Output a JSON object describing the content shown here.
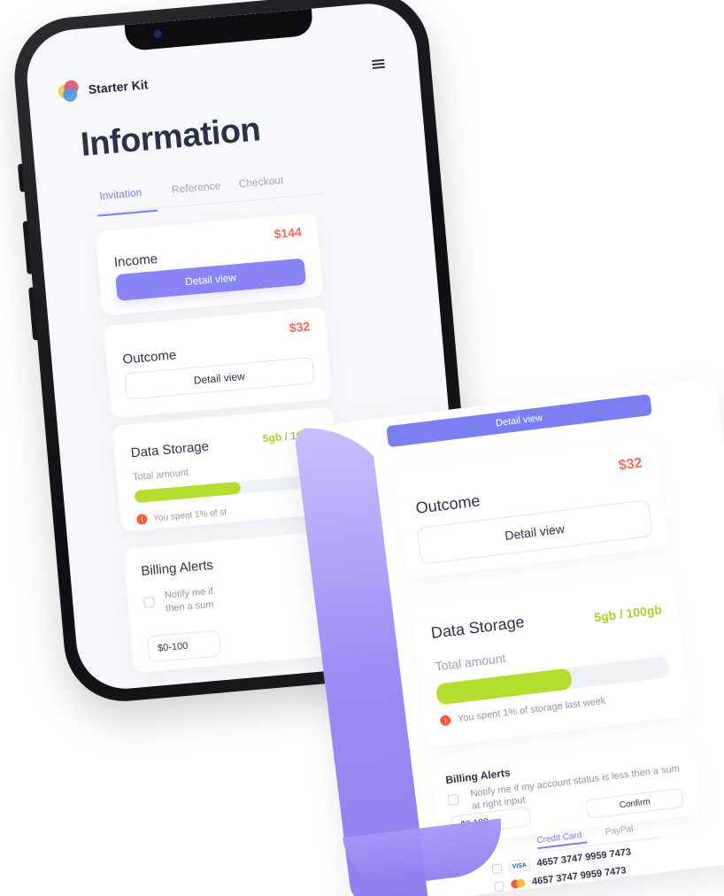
{
  "brand": {
    "name": "Starter Kit"
  },
  "page": {
    "title": "Information"
  },
  "tabs": [
    {
      "label": "Invitation"
    },
    {
      "label": "Reference"
    },
    {
      "label": "Checkout"
    }
  ],
  "phone": {
    "income": {
      "title": "Income",
      "amount": "$144",
      "button": "Detail view"
    },
    "outcome": {
      "title": "Outcome",
      "amount": "$32",
      "button": "Detail view"
    },
    "storage": {
      "title": "Data Storage",
      "metric": "5gb  /  100gb",
      "subtitle": "Total amount",
      "warning": "You spent 1% of st",
      "progress": 0.56
    },
    "billing": {
      "title": "Billing Alerts",
      "text_line1": "Notify me if",
      "text_line2": "then a sum",
      "select_value": "$0-100"
    }
  },
  "paper": {
    "top_button": "Detail view",
    "outcome": {
      "title": "Outcome",
      "amount": "$32",
      "button": "Detail view"
    },
    "storage": {
      "title": "Data Storage",
      "metric": "5gb  /  100gb",
      "subtitle": "Total amount",
      "warning": "You spent 1% of storage last week",
      "progress": 0.58
    },
    "billing": {
      "title": "Billing Alerts",
      "text": "Notify me if my account status is less then a sum at right input",
      "select_value": "$0-100",
      "confirm": "Confirm"
    },
    "payment_tabs": [
      {
        "label": "Credit Card"
      },
      {
        "label": "PayPal"
      }
    ],
    "payment_rows": [
      {
        "brand": "VISA",
        "number": "4657 3747 9959 7473"
      },
      {
        "brand": "mastercard",
        "number": "4657 3747 9959 7473"
      }
    ]
  },
  "icons": {
    "menu": "menu-icon",
    "logo": "starter-kit-logo",
    "warning": "warning-icon",
    "visa": "visa-icon",
    "mastercard": "mastercard-icon"
  },
  "colors": {
    "accent": "#7b7ff2",
    "accent_soft": "#8b84f6",
    "amount": "#ef6b5a",
    "storage": "#a6d234",
    "progress": "#b3dd2f",
    "paper_violet": "#8f80ef"
  }
}
